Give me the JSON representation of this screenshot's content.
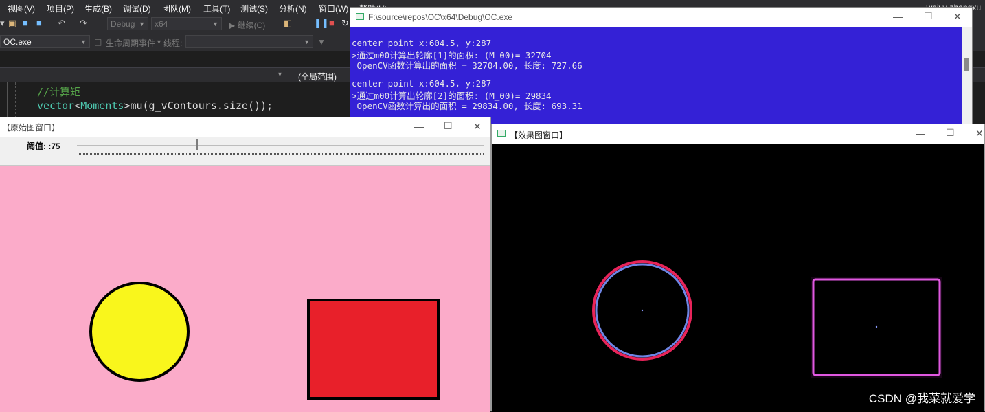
{
  "vs": {
    "menu": [
      "视图(V)",
      "项目(P)",
      "生成(B)",
      "调试(D)",
      "团队(M)",
      "工具(T)",
      "测试(S)",
      "分析(N)",
      "窗口(W)",
      "帮助(H)"
    ],
    "user": "weiyu zhangxu",
    "config_combo": "Debug",
    "platform_combo": "x64",
    "continue_label": "▶ 继续(C)",
    "process_combo": "OC.exe",
    "lifecycle_label": "生命周期事件",
    "thread_label": "线程:",
    "scope_label": "(全局范围)",
    "code": {
      "comment": "//计算矩",
      "line2_kw": "vector",
      "line2_lt": "<",
      "line2_type": "Moments",
      "line2_rest": ">mu(g_vContours.size());"
    }
  },
  "console": {
    "title": "F:\\source\\repos\\OC\\x64\\Debug\\OC.exe",
    "lines": [
      "center point x:604.5, y:287",
      ">通过m00计算出轮廓[1]的面积: (M_00)= 32704",
      " OpenCV函数计算出的面积 = 32704.00, 长度: 727.66",
      "",
      "center point x:604.5, y:287",
      ">通过m00计算出轮廓[2]的面积: (M_00)= 29834",
      " OpenCV函数计算出的面积 = 29834.00, 长度: 693.31"
    ],
    "colors": {
      "background": "#3421d6",
      "text": "#e6e6e6"
    }
  },
  "original_window": {
    "title": "【原始图窗口】",
    "trackbar_label": "阈值: :75",
    "trackbar_value": 75,
    "trackbar_max": 255,
    "colors": {
      "background": "#fbabc9",
      "circle": "#f9f61c",
      "rect": "#e8202a",
      "stroke": "#000000"
    }
  },
  "result_window": {
    "title": "【效果图窗口】",
    "colors": {
      "background": "#000000",
      "circle_outer": "#e8245a",
      "circle_inner": "#6f86e6",
      "rect": "#e058e0",
      "center": "#8a9bff"
    }
  },
  "watermark": "CSDN @我菜就爱学",
  "window_buttons": {
    "minimize": "—",
    "maximize": "☐",
    "close": "✕"
  }
}
